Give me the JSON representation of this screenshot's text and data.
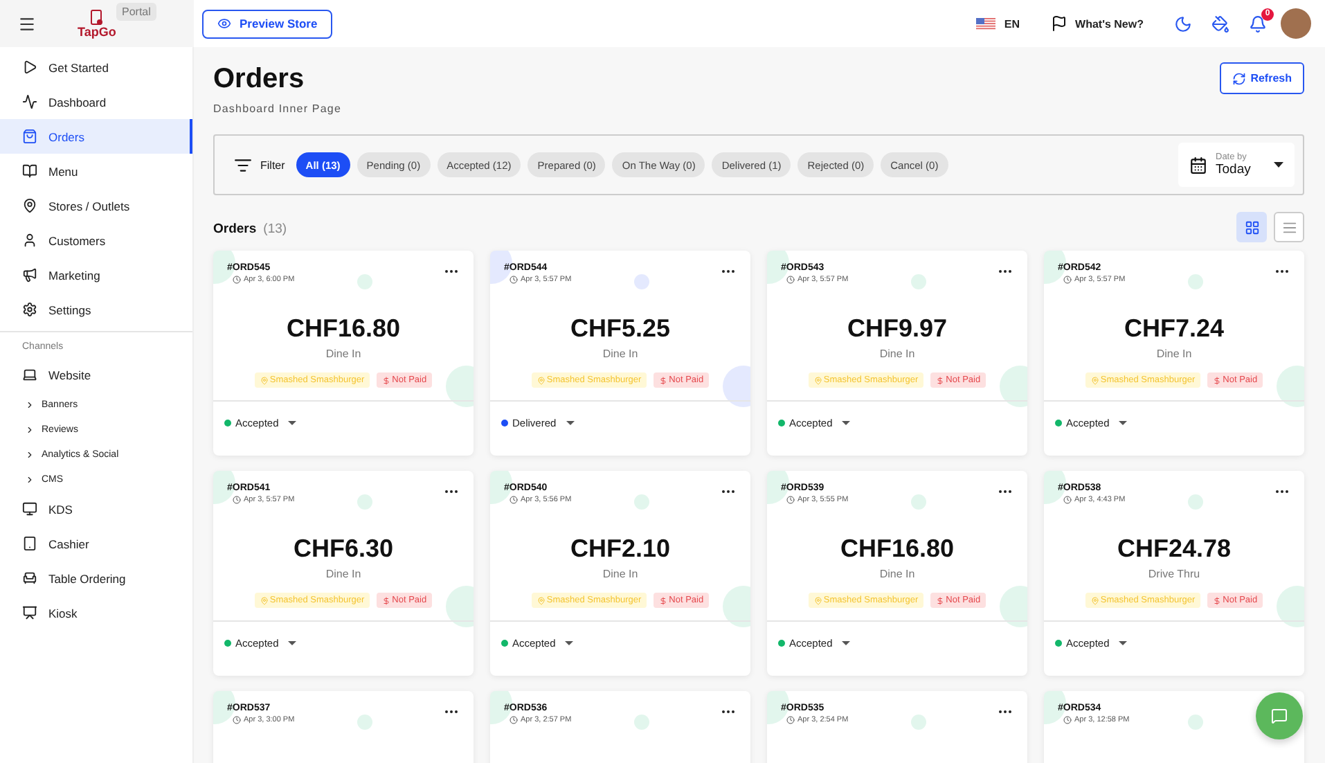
{
  "header": {
    "brand": "TapGo",
    "brand_badge": "Portal",
    "preview_button": "Preview Store",
    "language": "EN",
    "whats_new": "What's New?",
    "notification_count": "0"
  },
  "sidebar": {
    "items": [
      {
        "label": "Get Started",
        "selected": false
      },
      {
        "label": "Dashboard",
        "selected": false
      },
      {
        "label": "Orders",
        "selected": true
      },
      {
        "label": "Menu",
        "selected": false
      },
      {
        "label": "Stores / Outlets",
        "selected": false
      },
      {
        "label": "Customers",
        "selected": false
      },
      {
        "label": "Marketing",
        "selected": false
      },
      {
        "label": "Settings",
        "selected": false
      }
    ],
    "section_title": "Channels",
    "channels": [
      {
        "label": "Website",
        "selected": false,
        "children": [
          {
            "label": "Banners"
          },
          {
            "label": "Reviews"
          },
          {
            "label": "Analytics & Social"
          },
          {
            "label": "CMS"
          }
        ]
      },
      {
        "label": "KDS",
        "selected": false
      },
      {
        "label": "Cashier",
        "selected": false
      },
      {
        "label": "Table Ordering",
        "selected": false
      },
      {
        "label": "Kiosk",
        "selected": false
      }
    ]
  },
  "page": {
    "title": "Orders",
    "subtitle": "Dashboard Inner Page",
    "refresh_button": "Refresh"
  },
  "filter": {
    "label": "Filter",
    "chips": [
      {
        "label": "All (13)",
        "selected": true
      },
      {
        "label": "Pending (0)",
        "selected": false
      },
      {
        "label": "Accepted (12)",
        "selected": false
      },
      {
        "label": "Prepared (0)",
        "selected": false
      },
      {
        "label": "On The Way (0)",
        "selected": false
      },
      {
        "label": "Delivered (1)",
        "selected": false
      },
      {
        "label": "Rejected (0)",
        "selected": false
      },
      {
        "label": "Cancel (0)",
        "selected": false
      }
    ],
    "date_by": {
      "label": "Date by",
      "value": "Today"
    }
  },
  "orders_section": {
    "title": "Orders",
    "count": "(13)",
    "views": [
      {
        "kind": "grid",
        "selected": true
      },
      {
        "kind": "list",
        "selected": false
      }
    ]
  },
  "orders": [
    {
      "id": "#ORD545",
      "time": "Apr 3, 6:00 PM",
      "amount": "CHF16.80",
      "type": "Dine In",
      "store": "Smashed Smashburger",
      "payment": "Not Paid",
      "status": "Accepted",
      "color": "#12b76a"
    },
    {
      "id": "#ORD544",
      "time": "Apr 3, 5:57 PM",
      "amount": "CHF5.25",
      "type": "Dine In",
      "store": "Smashed Smashburger",
      "payment": "Not Paid",
      "status": "Delivered",
      "color": "#1d4ef5"
    },
    {
      "id": "#ORD543",
      "time": "Apr 3, 5:57 PM",
      "amount": "CHF9.97",
      "type": "Dine In",
      "store": "Smashed Smashburger",
      "payment": "Not Paid",
      "status": "Accepted",
      "color": "#12b76a"
    },
    {
      "id": "#ORD542",
      "time": "Apr 3, 5:57 PM",
      "amount": "CHF7.24",
      "type": "Dine In",
      "store": "Smashed Smashburger",
      "payment": "Not Paid",
      "status": "Accepted",
      "color": "#12b76a"
    },
    {
      "id": "#ORD541",
      "time": "Apr 3, 5:57 PM",
      "amount": "CHF6.30",
      "type": "Dine In",
      "store": "Smashed Smashburger",
      "payment": "Not Paid",
      "status": "Accepted",
      "color": "#12b76a"
    },
    {
      "id": "#ORD540",
      "time": "Apr 3, 5:56 PM",
      "amount": "CHF2.10",
      "type": "Dine In",
      "store": "Smashed Smashburger",
      "payment": "Not Paid",
      "status": "Accepted",
      "color": "#12b76a"
    },
    {
      "id": "#ORD539",
      "time": "Apr 3, 5:55 PM",
      "amount": "CHF16.80",
      "type": "Dine In",
      "store": "Smashed Smashburger",
      "payment": "Not Paid",
      "status": "Accepted",
      "color": "#12b76a"
    },
    {
      "id": "#ORD538",
      "time": "Apr 3, 4:43 PM",
      "amount": "CHF24.78",
      "type": "Drive Thru",
      "store": "Smashed Smashburger",
      "payment": "Not Paid",
      "status": "Accepted",
      "color": "#12b76a"
    },
    {
      "id": "#ORD537",
      "time": "Apr 3, 3:00 PM"
    },
    {
      "id": "#ORD536",
      "time": "Apr 3, 2:57 PM"
    },
    {
      "id": "#ORD535",
      "time": "Apr 3, 2:54 PM"
    },
    {
      "id": "#ORD534",
      "time": "Apr 3, 12:58 PM"
    }
  ]
}
